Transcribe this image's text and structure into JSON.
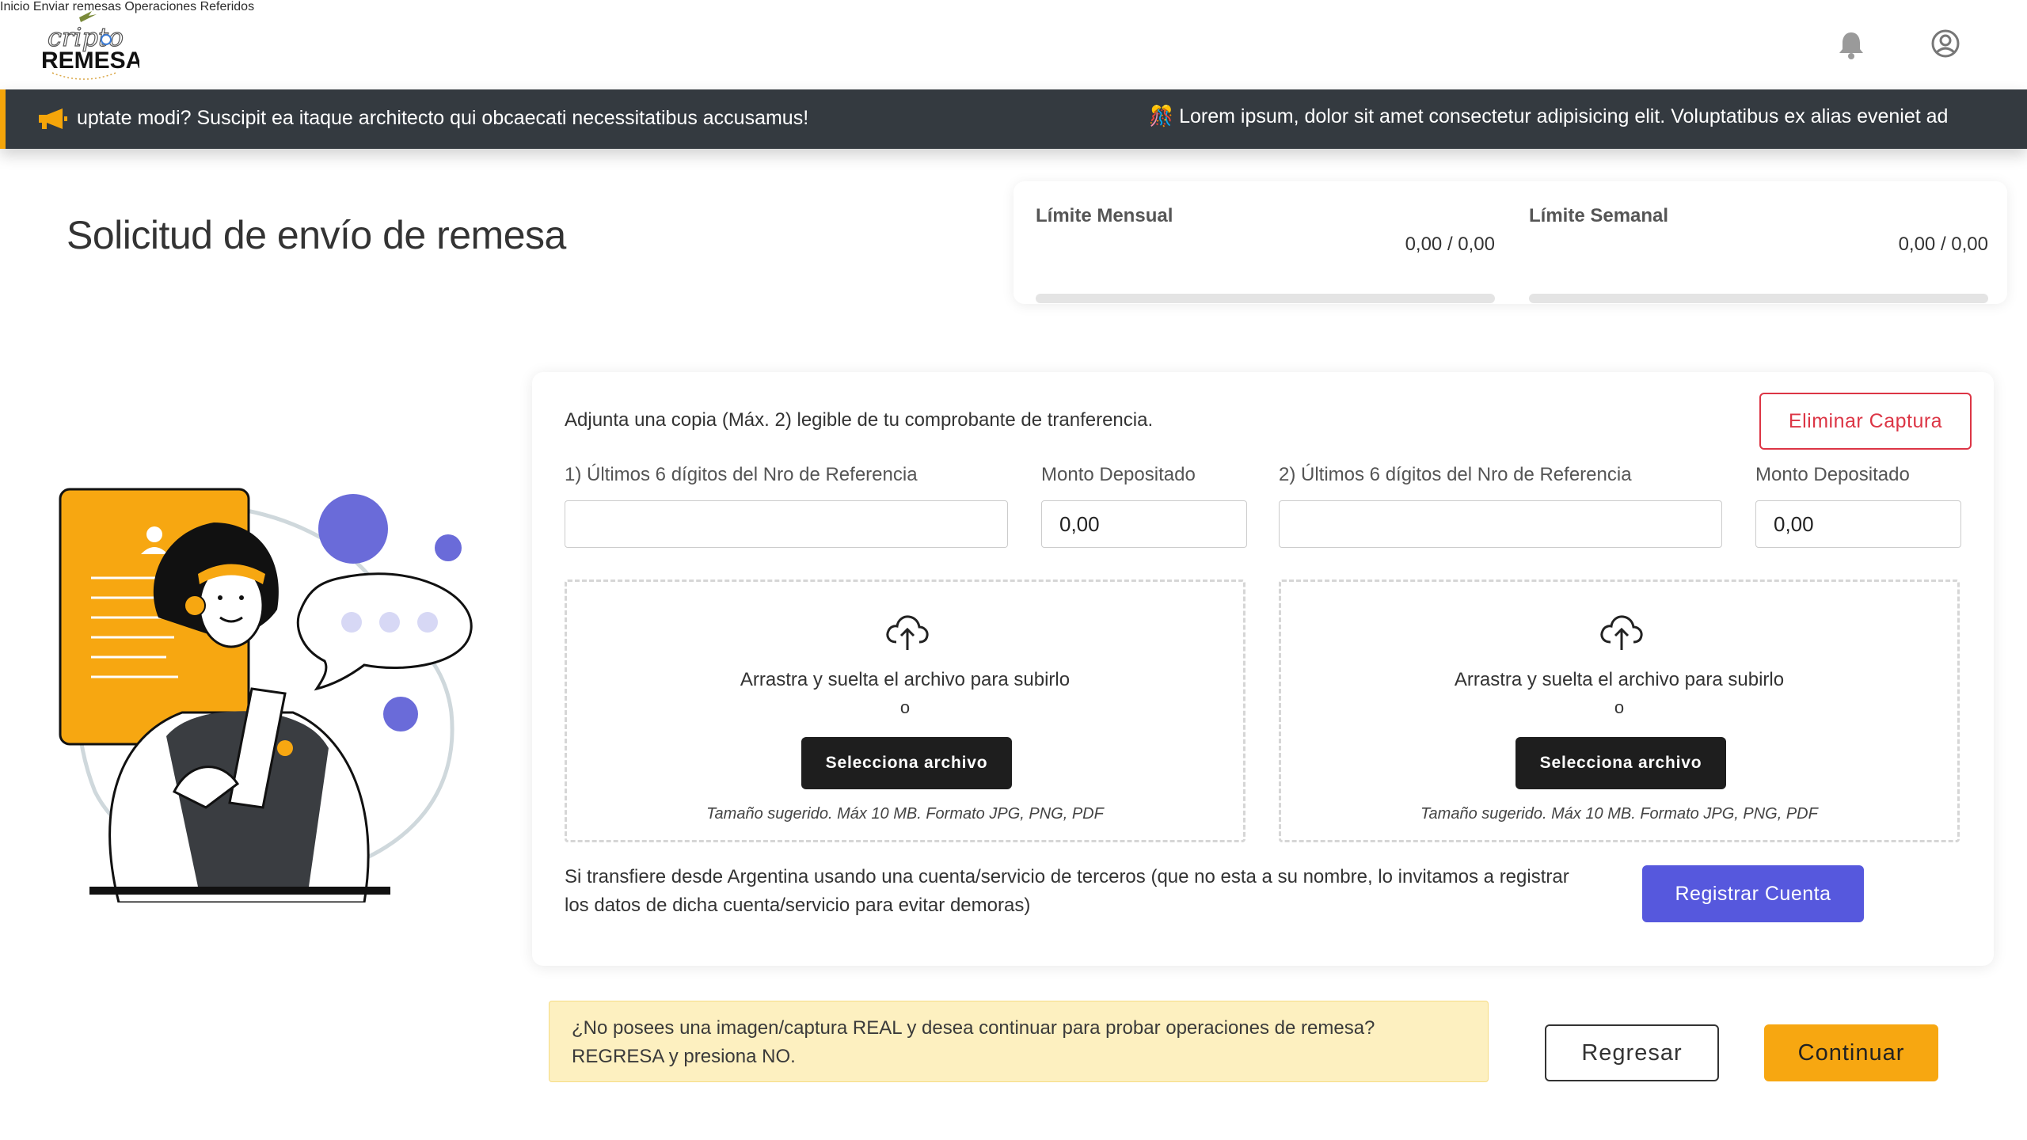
{
  "header": {
    "logo_top": "cripto",
    "logo_bottom": "REMESA",
    "nav": [
      "Inicio",
      "Enviar remesas",
      "Operaciones",
      "Referidos"
    ],
    "icons": [
      "bell-icon",
      "user-circle-icon"
    ]
  },
  "ticker": {
    "icon": "megaphone-icon",
    "message_1": "uptate modi? Suscipit ea itaque architecto qui obcaecati necessitatibus accusamus!",
    "message_2_icon": "confetti-icon",
    "message_2": "Lorem ipsum, dolor sit amet consectetur adipisicing elit. Voluptatibus ex alias eveniet ad"
  },
  "page": {
    "title": "Solicitud de envío de remesa"
  },
  "limits": {
    "monthly": {
      "label": "Límite Mensual",
      "value": "0,00 / 0,00",
      "progress": 0
    },
    "weekly": {
      "label": "Límite Semanal",
      "value": "0,00 / 0,00",
      "progress": 0
    }
  },
  "form": {
    "instructions": "Adjunta una copia (Máx. 2) legible de tu comprobante de tranferencia.",
    "delete_button": "Eliminar Captura",
    "ref1_label": "1) Últimos 6 dígitos del Nro de Referencia",
    "ref1_value": "",
    "amount1_label": "Monto Depositado",
    "amount1_value": "0,00",
    "ref2_label": "2) Últimos 6 dígitos del Nro de Referencia",
    "ref2_value": "",
    "amount2_label": "Monto Depositado",
    "amount2_value": "0,00",
    "dropzone": {
      "icon": "cloud-upload-icon",
      "text": "Arrastra y suelta el archivo para subirlo",
      "or": "o",
      "button": "Selecciona archivo",
      "hint": "Tamaño sugerido. Máx 10 MB. Formato JPG, PNG, PDF"
    },
    "third_party_note": "Si transfiere desde Argentina usando una cuenta/servicio de terceros (que no esta a su nombre, lo invitamos a registrar los datos de dicha cuenta/servicio para evitar demoras)",
    "register_button": "Registrar Cuenta"
  },
  "alert": {
    "text": "¿No posees una imagen/captura REAL y desea continuar para probar operaciones de remesa? REGRESA y presiona NO."
  },
  "actions": {
    "back": "Regresar",
    "continue": "Continuar"
  },
  "colors": {
    "accent": "#f7a711",
    "primary": "#5658dd",
    "danger": "#dc3545",
    "dark": "#343a40"
  }
}
